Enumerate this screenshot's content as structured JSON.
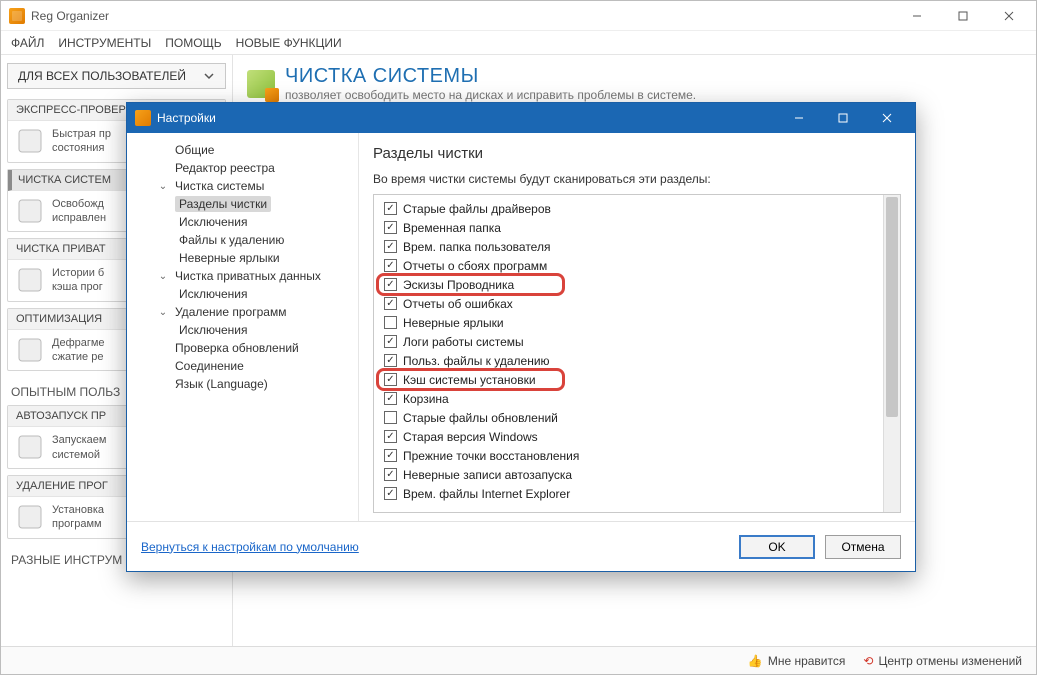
{
  "app": {
    "title": "Reg Organizer"
  },
  "menu": [
    "ФАЙЛ",
    "ИНСТРУМЕНТЫ",
    "ПОМОЩЬ",
    "НОВЫЕ ФУНКЦИИ"
  ],
  "scope_button": "ДЛЯ ВСЕХ ПОЛЬЗОВАТЕЛЕЙ",
  "sidebar": {
    "sections": [
      {
        "header": "ЭКСПРЕСС-ПРОВЕРКА",
        "line1": "Быстрая пр",
        "line2": "состояния"
      },
      {
        "header": "ЧИСТКА СИСТЕМ",
        "selected": true,
        "line1": "Освобожд",
        "line2": "исправлен"
      },
      {
        "header": "ЧИСТКА ПРИВАТ",
        "line1": "Истории б",
        "line2": "кэша прог"
      },
      {
        "header": "ОПТИМИЗАЦИЯ",
        "line1": "Дефрагме",
        "line2": "сжатие ре"
      }
    ],
    "group_title": "ОПЫТНЫМ ПОЛЬЗ",
    "sections2": [
      {
        "header": "АВТОЗАПУСК ПР",
        "line1": "Запускаем",
        "line2": "системой"
      },
      {
        "header": "УДАЛЕНИЕ ПРОГ",
        "line1": "Установка",
        "line2": "программ"
      }
    ],
    "footer": "РАЗНЫЕ ИНСТРУМ"
  },
  "content": {
    "title": "ЧИСТКА СИСТЕМЫ",
    "subtitle": "позволяет освободить место на дисках и исправить проблемы в системе."
  },
  "statusbar": {
    "like": "Мне нравится",
    "undo": "Центр отмены изменений"
  },
  "modal": {
    "title": "Настройки",
    "tree": [
      {
        "label": "Общие",
        "level": 1
      },
      {
        "label": "Редактор реестра",
        "level": 1
      },
      {
        "label": "Чистка системы",
        "level": 1,
        "expanded": true
      },
      {
        "label": "Разделы чистки",
        "level": 2,
        "selected": true
      },
      {
        "label": "Исключения",
        "level": 2
      },
      {
        "label": "Файлы к удалению",
        "level": 2
      },
      {
        "label": "Неверные ярлыки",
        "level": 2
      },
      {
        "label": "Чистка приватных данных",
        "level": 1,
        "expanded": true
      },
      {
        "label": "Исключения",
        "level": 2
      },
      {
        "label": "Удаление программ",
        "level": 1,
        "expanded": true
      },
      {
        "label": "Исключения",
        "level": 2
      },
      {
        "label": "Проверка обновлений",
        "level": 1
      },
      {
        "label": "Соединение",
        "level": 1
      },
      {
        "label": "Язык (Language)",
        "level": 1
      }
    ],
    "pane": {
      "title": "Разделы чистки",
      "subtitle": "Во время чистки системы будут сканироваться эти разделы:",
      "items": [
        {
          "label": "Старые файлы драйверов",
          "checked": true
        },
        {
          "label": "Временная папка",
          "checked": true
        },
        {
          "label": "Врем. папка пользователя",
          "checked": true
        },
        {
          "label": "Отчеты о сбоях программ",
          "checked": true
        },
        {
          "label": "Эскизы Проводника",
          "checked": true,
          "highlight": true
        },
        {
          "label": "Отчеты об ошибках",
          "checked": true
        },
        {
          "label": "Неверные ярлыки",
          "checked": false
        },
        {
          "label": "Логи работы системы",
          "checked": true
        },
        {
          "label": "Польз. файлы к удалению",
          "checked": true
        },
        {
          "label": "Кэш системы установки",
          "checked": true,
          "highlight": true
        },
        {
          "label": "Корзина",
          "checked": true
        },
        {
          "label": "Старые файлы обновлений",
          "checked": false
        },
        {
          "label": "Старая версия Windows",
          "checked": true
        },
        {
          "label": "Прежние точки восстановления",
          "checked": true
        },
        {
          "label": "Неверные записи автозапуска",
          "checked": true
        },
        {
          "label": "Врем. файлы Internet Explorer",
          "checked": true
        }
      ]
    },
    "footer": {
      "reset_link": "Вернуться к настройкам по умолчанию",
      "ok": "OK",
      "cancel": "Отмена"
    }
  }
}
